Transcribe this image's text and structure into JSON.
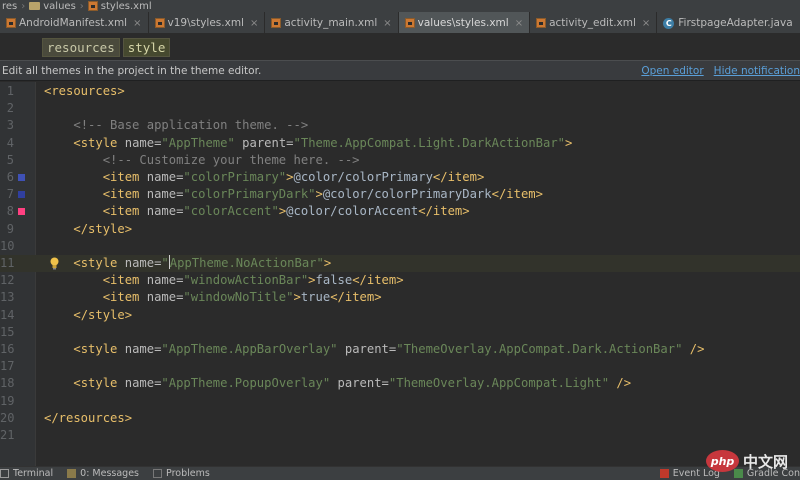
{
  "breadcrumb": {
    "items": [
      "res",
      "values",
      "styles.xml"
    ]
  },
  "tabs": [
    {
      "label": "AndroidManifest.xml",
      "icon": "xml-file-icon",
      "active": false
    },
    {
      "label": "v19\\styles.xml",
      "icon": "xml-file-icon",
      "active": false
    },
    {
      "label": "activity_main.xml",
      "icon": "xml-file-icon",
      "active": false
    },
    {
      "label": "values\\styles.xml",
      "icon": "xml-file-icon",
      "active": true
    },
    {
      "label": "activity_edit.xml",
      "icon": "xml-file-icon",
      "active": false
    },
    {
      "label": "FirstpageAdapter.java",
      "icon": "java-class-icon",
      "active": false
    }
  ],
  "tag_path": [
    "resources",
    "style"
  ],
  "notice": {
    "message": "Edit all themes in the project in the theme editor.",
    "open_editor": "Open editor",
    "hide_notification": "Hide notification"
  },
  "editor": {
    "current_line": 11,
    "lines": [
      {
        "n": "1",
        "text": "<resources>"
      },
      {
        "n": "2",
        "text": ""
      },
      {
        "n": "3",
        "text": "    <!-- Base application theme. -->"
      },
      {
        "n": "4",
        "text": "    <style name=\"AppTheme\" parent=\"Theme.AppCompat.Light.DarkActionBar\">"
      },
      {
        "n": "5",
        "text": "        <!-- Customize your theme here. -->"
      },
      {
        "n": "6",
        "text": "        <item name=\"colorPrimary\">@color/colorPrimary</item>"
      },
      {
        "n": "7",
        "text": "        <item name=\"colorPrimaryDark\">@color/colorPrimaryDark</item>"
      },
      {
        "n": "8",
        "text": "        <item name=\"colorAccent\">@color/colorAccent</item>"
      },
      {
        "n": "9",
        "text": "    </style>"
      },
      {
        "n": "10",
        "text": ""
      },
      {
        "n": "11",
        "text": "    <style name=\"AppTheme.NoActionBar\">"
      },
      {
        "n": "12",
        "text": "        <item name=\"windowActionBar\">false</item>"
      },
      {
        "n": "13",
        "text": "        <item name=\"windowNoTitle\">true</item>"
      },
      {
        "n": "14",
        "text": "    </style>"
      },
      {
        "n": "15",
        "text": ""
      },
      {
        "n": "16",
        "text": "    <style name=\"AppTheme.AppBarOverlay\" parent=\"ThemeOverlay.AppCompat.Dark.ActionBar\" />"
      },
      {
        "n": "17",
        "text": ""
      },
      {
        "n": "18",
        "text": "    <style name=\"AppTheme.PopupOverlay\" parent=\"ThemeOverlay.AppCompat.Light\" />"
      },
      {
        "n": "19",
        "text": ""
      },
      {
        "n": "20",
        "text": "</resources>"
      },
      {
        "n": "21",
        "text": ""
      }
    ],
    "color_swatches": {
      "6": "#3f51b5",
      "7": "#303f9f",
      "8": "#ff4081"
    }
  },
  "statusbar": {
    "left": [
      "Terminal",
      "0: Messages",
      "Problems"
    ],
    "right": [
      "Event Log",
      "Gradle Con"
    ]
  },
  "watermark": {
    "logo": "php",
    "text": "中文网"
  }
}
